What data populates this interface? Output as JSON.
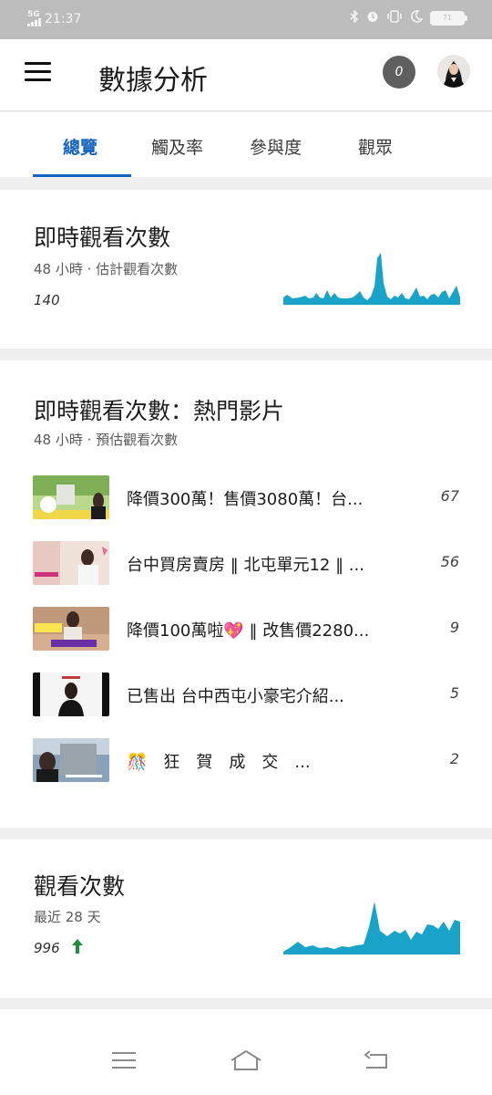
{
  "status_bar": {
    "network": "5G",
    "time": "21:37",
    "battery": "71",
    "icons": [
      "bluetooth-icon",
      "alarm-icon",
      "vibrate-icon",
      "moon-icon",
      "battery-icon"
    ]
  },
  "app_bar": {
    "title": "數據分析",
    "notification_count": "0"
  },
  "tabs": [
    {
      "label": "總覽",
      "active": true
    },
    {
      "label": "觸及率",
      "active": false
    },
    {
      "label": "參與度",
      "active": false
    },
    {
      "label": "觀眾",
      "active": false
    }
  ],
  "realtime_card": {
    "title": "即時觀看次數",
    "subtitle": "48 小時 · 估計觀看次數",
    "value": "140"
  },
  "top_videos_card": {
    "title": "即時觀看次數：熱門影片",
    "subtitle": "48 小時 · 預估觀看次數",
    "videos": [
      {
        "title": "降價300萬！售價3080萬！台...",
        "count": "67"
      },
      {
        "title": "台中買房賣房 ‖ 北屯單元12 ‖ ...",
        "count": "56"
      },
      {
        "title": "降價100萬啦💖 ‖ 改售價2280...",
        "count": "9"
      },
      {
        "title": "已售出 台中西屯小豪宅介紹...",
        "count": "5"
      },
      {
        "title": "🎊　狂　賀　成　交　...",
        "count": "2"
      }
    ]
  },
  "views_card": {
    "title": "觀看次數",
    "subtitle": "最近 28 天",
    "value": "996",
    "trend": "up",
    "trend_color": "#1e8e3e"
  },
  "colors": {
    "accent": "#1565c0",
    "chart": "#1aa3c8"
  },
  "nav_icons": [
    "menu-lines-icon",
    "home-outline-icon",
    "back-arrow-icon"
  ]
}
